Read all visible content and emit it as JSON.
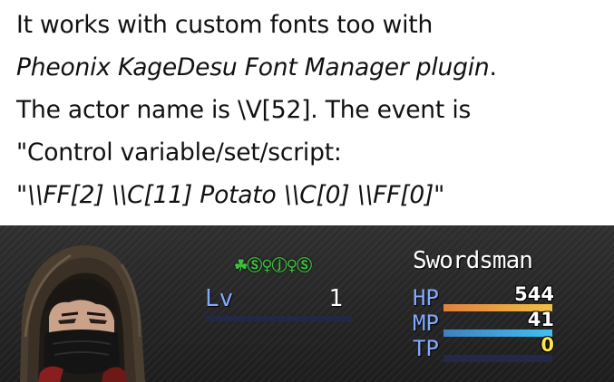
{
  "caption": {
    "line1": "It works with custom fonts too with",
    "line2_plugin": "Pheonix KageDesu Font Manager plugin",
    "line2_end": ".",
    "line3": "The actor name is \\V[52]. The event is",
    "line4": "\"Control variable/set/script:",
    "line5_open": "\"",
    "line5_italic": "\\\\FF[2] \\\\C[11] Potato \\\\C[0] \\\\FF[0]",
    "line5_close": "\""
  },
  "status": {
    "actor_name": "☘Ⓢ♀ⓙ♀Ⓢ",
    "level_label": "Lv",
    "level_value": "1",
    "class_name": "Swordsman",
    "hp_label": "HP",
    "hp_value": "544",
    "hp_ratio": 1.0,
    "mp_label": "MP",
    "mp_value": "41",
    "mp_ratio": 1.0,
    "tp_label": "TP",
    "tp_value": "0",
    "tp_ratio": 0.0
  },
  "colors": {
    "system_label": "#84aaff",
    "name_green": "#3fbf3f",
    "hp_gradient": [
      "#e08040",
      "#f0c040"
    ],
    "mp_gradient": [
      "#4080c0",
      "#40c0f0"
    ],
    "tp_gradient": [
      "#00a040",
      "#80ff80"
    ],
    "gauge_back": "#232848"
  }
}
